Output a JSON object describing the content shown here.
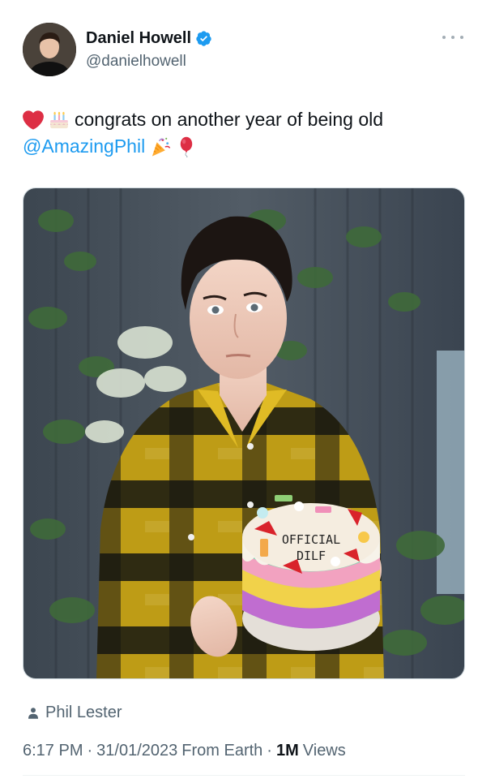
{
  "author": {
    "display_name": "Daniel Howell",
    "handle": "@danielhowell",
    "verified": true
  },
  "tweet": {
    "text_line1": "congrats on another year of being old",
    "mention": "@AmazingPhil",
    "emojis_line1": [
      "heart-emoji",
      "birthday-cake-emoji"
    ],
    "emojis_line2": [
      "party-popper-emoji",
      "balloon-emoji"
    ]
  },
  "media": {
    "cake_text_line1": "OFFICIAL",
    "cake_text_line2": "DILF"
  },
  "tagged_person": "Phil Lester",
  "meta": {
    "time": "6:17 PM",
    "date": "31/01/2023",
    "source": "From Earth",
    "views_count": "1M",
    "views_label": "Views"
  },
  "colors": {
    "link": "#1d9bf0",
    "secondary_text": "#536471",
    "primary_text": "#0f1419",
    "verified_badge": "#1d9bf0"
  }
}
